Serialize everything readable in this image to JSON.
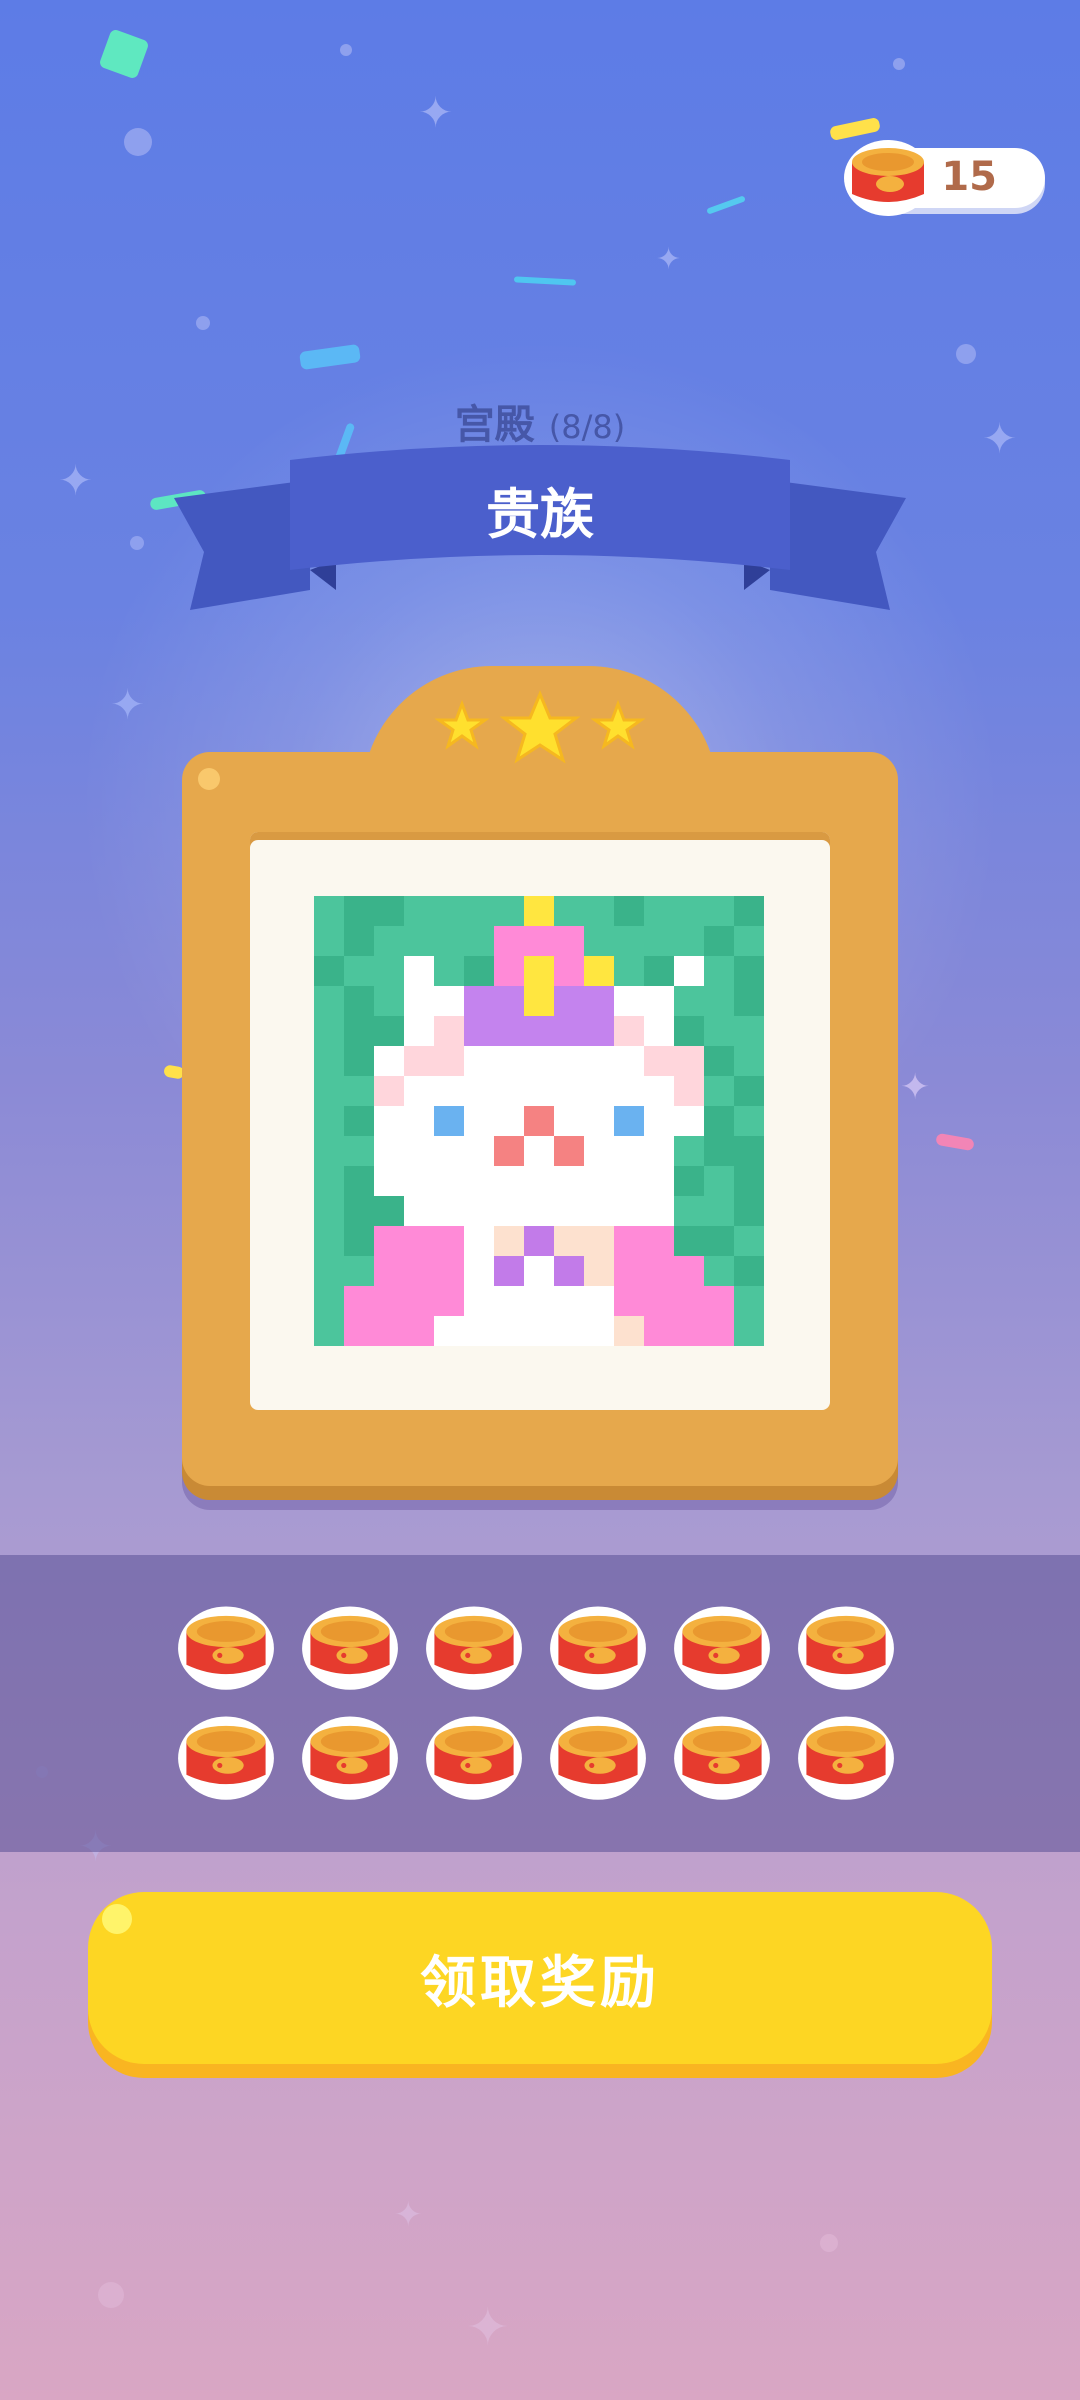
{
  "currency": {
    "count": "15",
    "icon": "cat-food-can-icon"
  },
  "level": {
    "category": "宫殿",
    "progress": "(8/8)",
    "title": "贵族",
    "stars": 3
  },
  "artwork": {
    "name": "noble-cat-pixel-art",
    "palette": {
      "G": "#4cc59c",
      "D": "#3ab38a",
      "W": "#ffffff",
      "P": "#ff8ad7",
      "L": "#c483ee",
      "Y": "#ffe640",
      "K": "#ffd6dc",
      "B": "#6ab2f0",
      "N": "#f58282",
      "C": "#fde1cf",
      "V": "#c27be9"
    }
  },
  "rewards": {
    "icon": "cat-food-can-icon",
    "count": 12
  },
  "claim_button": {
    "label": "领取奖励"
  },
  "colors": {
    "accent_yellow": "#fdd623",
    "frame_gold": "#e6a84c",
    "ribbon_blue": "#4b5fcc",
    "currency_text": "#b06a4a"
  }
}
